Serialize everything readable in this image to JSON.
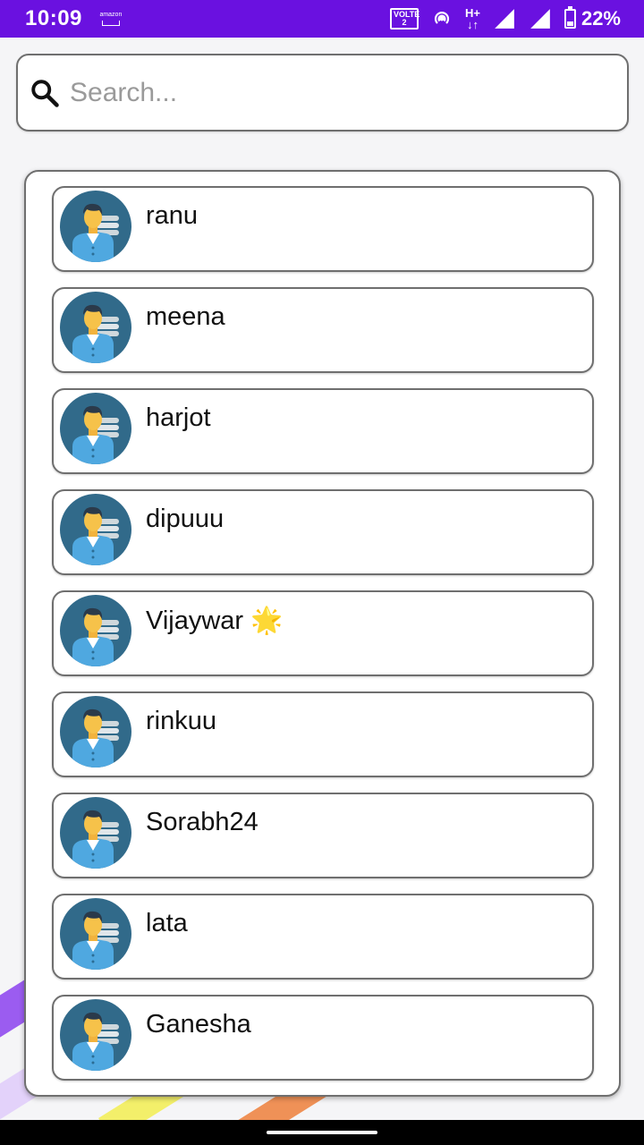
{
  "status_bar": {
    "time": "10:09",
    "amazon_label": "amazon",
    "volte_label": "VOLTE",
    "volte_sim": "2",
    "network_type": "H+",
    "battery_percent": "22%",
    "background_color": "#6a11e0"
  },
  "search": {
    "placeholder": "Search...",
    "value": "",
    "icon": "search-icon"
  },
  "contacts": {
    "avatar_icon": "person-avatar-icon",
    "items": [
      {
        "name": "ranu"
      },
      {
        "name": "meena"
      },
      {
        "name": "harjot"
      },
      {
        "name": "dipuuu"
      },
      {
        "name": "Vijaywar 🌟"
      },
      {
        "name": "rinkuu"
      },
      {
        "name": "Sorabh24"
      },
      {
        "name": "lata"
      },
      {
        "name": "Ganesha"
      }
    ]
  },
  "colors": {
    "avatar_bg": "#316a8a",
    "border": "#6f6f6f"
  }
}
